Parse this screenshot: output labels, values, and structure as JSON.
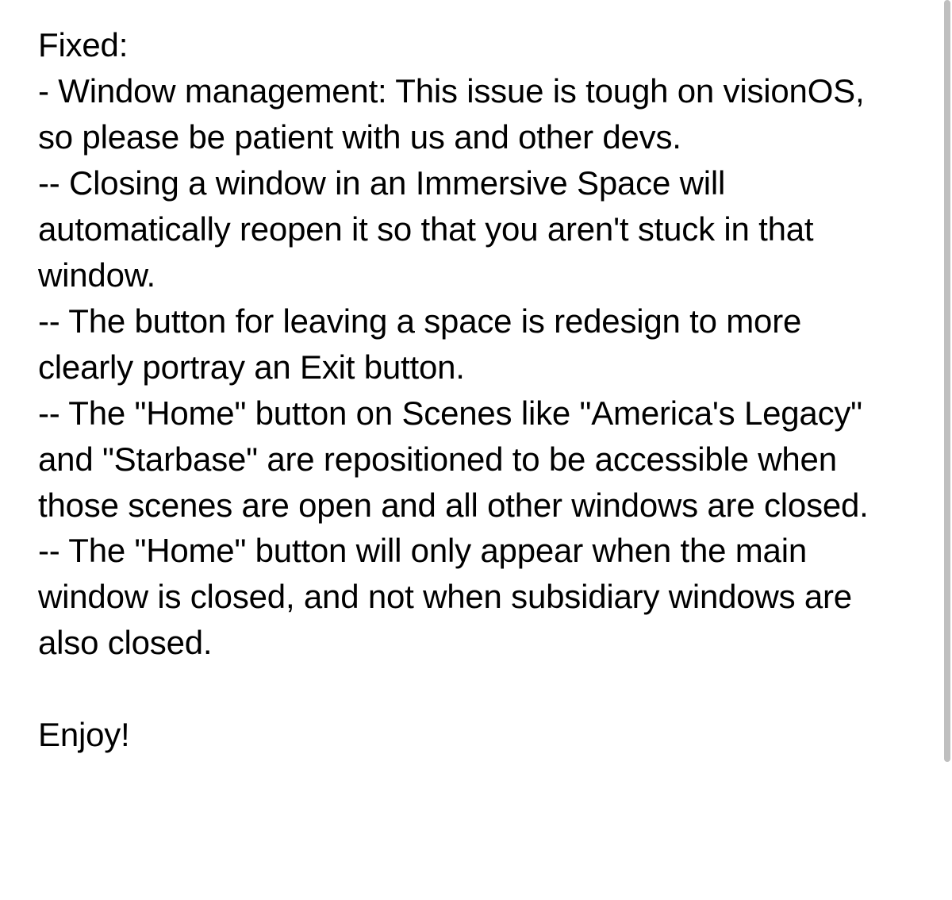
{
  "release_notes": {
    "heading": "Fixed:",
    "items": [
      "- Window management: This issue is tough on visionOS, so please be patient with us and other devs.",
      "-- Closing a window in an Immersive Space will automatically reopen it so that you aren't stuck in that window.",
      "-- The button for leaving a space is redesign to more clearly portray an Exit button.",
      "-- The \"Home\" button on Scenes like \"America's Legacy\" and \"Starbase\" are repositioned to be accessible when those scenes are open and all other windows are closed.",
      "-- The \"Home\" button will only appear when the main window is closed, and not when subsidiary windows are also closed."
    ],
    "closing": "Enjoy!"
  }
}
